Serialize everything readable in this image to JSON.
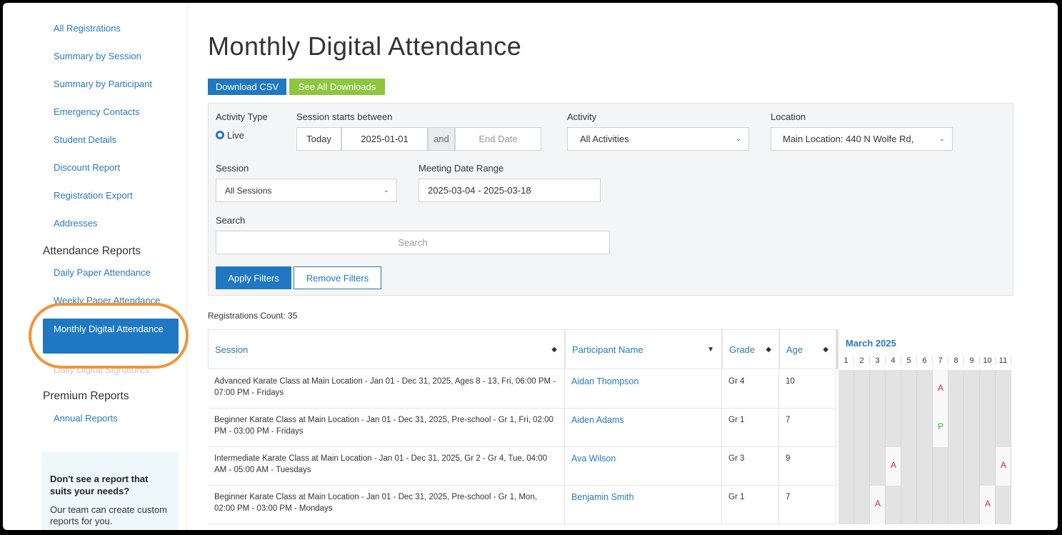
{
  "sidebar": {
    "links": [
      {
        "label": "All Registrations"
      },
      {
        "label": "Summary by Session"
      },
      {
        "label": "Summary by Participant"
      },
      {
        "label": "Emergency Contacts"
      },
      {
        "label": "Student Details"
      },
      {
        "label": "Discount Report"
      },
      {
        "label": "Registration Export"
      },
      {
        "label": "Addresses"
      }
    ],
    "attendance_heading": "Attendance Reports",
    "attendance_links": [
      {
        "label": "Daily Paper Attendance"
      },
      {
        "label": "Weekly Paper Attendance"
      }
    ],
    "active_item": "Monthly Digital Attendance",
    "obscured_item": "Daily Digital Signatures",
    "premium_heading": "Premium Reports",
    "premium_links": [
      {
        "label": "Annual Reports"
      }
    ],
    "help_title": "Don't see a report that suits your needs?",
    "help_text": "Our team can create custom reports for you.",
    "highlight_color": "#f0953a"
  },
  "page": {
    "title": "Monthly Digital Attendance",
    "download_csv": "Download CSV",
    "see_all_downloads": "See All Downloads"
  },
  "filters": {
    "activity_type_label": "Activity Type",
    "activity_type_value": "Live",
    "session_starts_label": "Session starts between",
    "today_btn": "Today",
    "start_date": "2025-01-01",
    "and_text": "and",
    "end_date_placeholder": "End Date",
    "activity_label": "Activity",
    "activity_value": "All Activities",
    "location_label": "Location",
    "location_value": "Main Location: 440 N Wolfe Rd,",
    "session_label": "Session",
    "session_value": "All Sessions",
    "meeting_range_label": "Meeting Date Range",
    "meeting_range_value": "2025-03-04 - 2025-03-18",
    "search_label": "Search",
    "search_placeholder": "Search",
    "apply_btn": "Apply Filters",
    "remove_btn": "Remove Filters"
  },
  "registrations_count": "Registrations Count: 35",
  "table": {
    "headers": {
      "session": "Session",
      "participant": "Participant Name",
      "grade": "Grade",
      "age": "Age"
    },
    "calendar_month": "March 2025",
    "days": [
      "1",
      "2",
      "3",
      "4",
      "5",
      "6",
      "7",
      "8",
      "9",
      "10",
      "11"
    ],
    "rows": [
      {
        "session": "Advanced Karate Class at Main Location - Jan 01 - Dec 31, 2025, Ages 8 - 13, Fri, 06:00 PM - 07:00 PM - Fridays",
        "name": "Aidan Thompson",
        "grade": "Gr 4",
        "age": "10",
        "marks": {
          "7": "A"
        }
      },
      {
        "session": "Beginner Karate Class at Main Location - Jan 01 - Dec 31, 2025, Pre-school - Gr 1, Fri, 02:00 PM - 03:00 PM - Fridays",
        "name": "Aiden Adams",
        "grade": "Gr 1",
        "age": "7",
        "marks": {
          "7": "P"
        }
      },
      {
        "session": "Intermediate Karate Class at Main Location - Jan 01 - Dec 31, 2025, Gr 2 - Gr 4, Tue, 04:00 AM - 05:00 AM - Tuesdays",
        "name": "Ava Wilson",
        "grade": "Gr 3",
        "age": "9",
        "marks": {
          "4": "A",
          "11": "A"
        }
      },
      {
        "session": "Beginner Karate Class at Main Location - Jan 01 - Dec 31, 2025, Pre-school - Gr 1, Mon, 02:00 PM - 03:00 PM - Mondays",
        "name": "Benjamin Smith",
        "grade": "Gr 1",
        "age": "7",
        "marks": {
          "3": "A",
          "10": "A"
        }
      }
    ]
  },
  "colors": {
    "primary": "#1f78c1",
    "green": "#8dc63f",
    "absent": "#d62728",
    "present": "#3aa83a"
  }
}
